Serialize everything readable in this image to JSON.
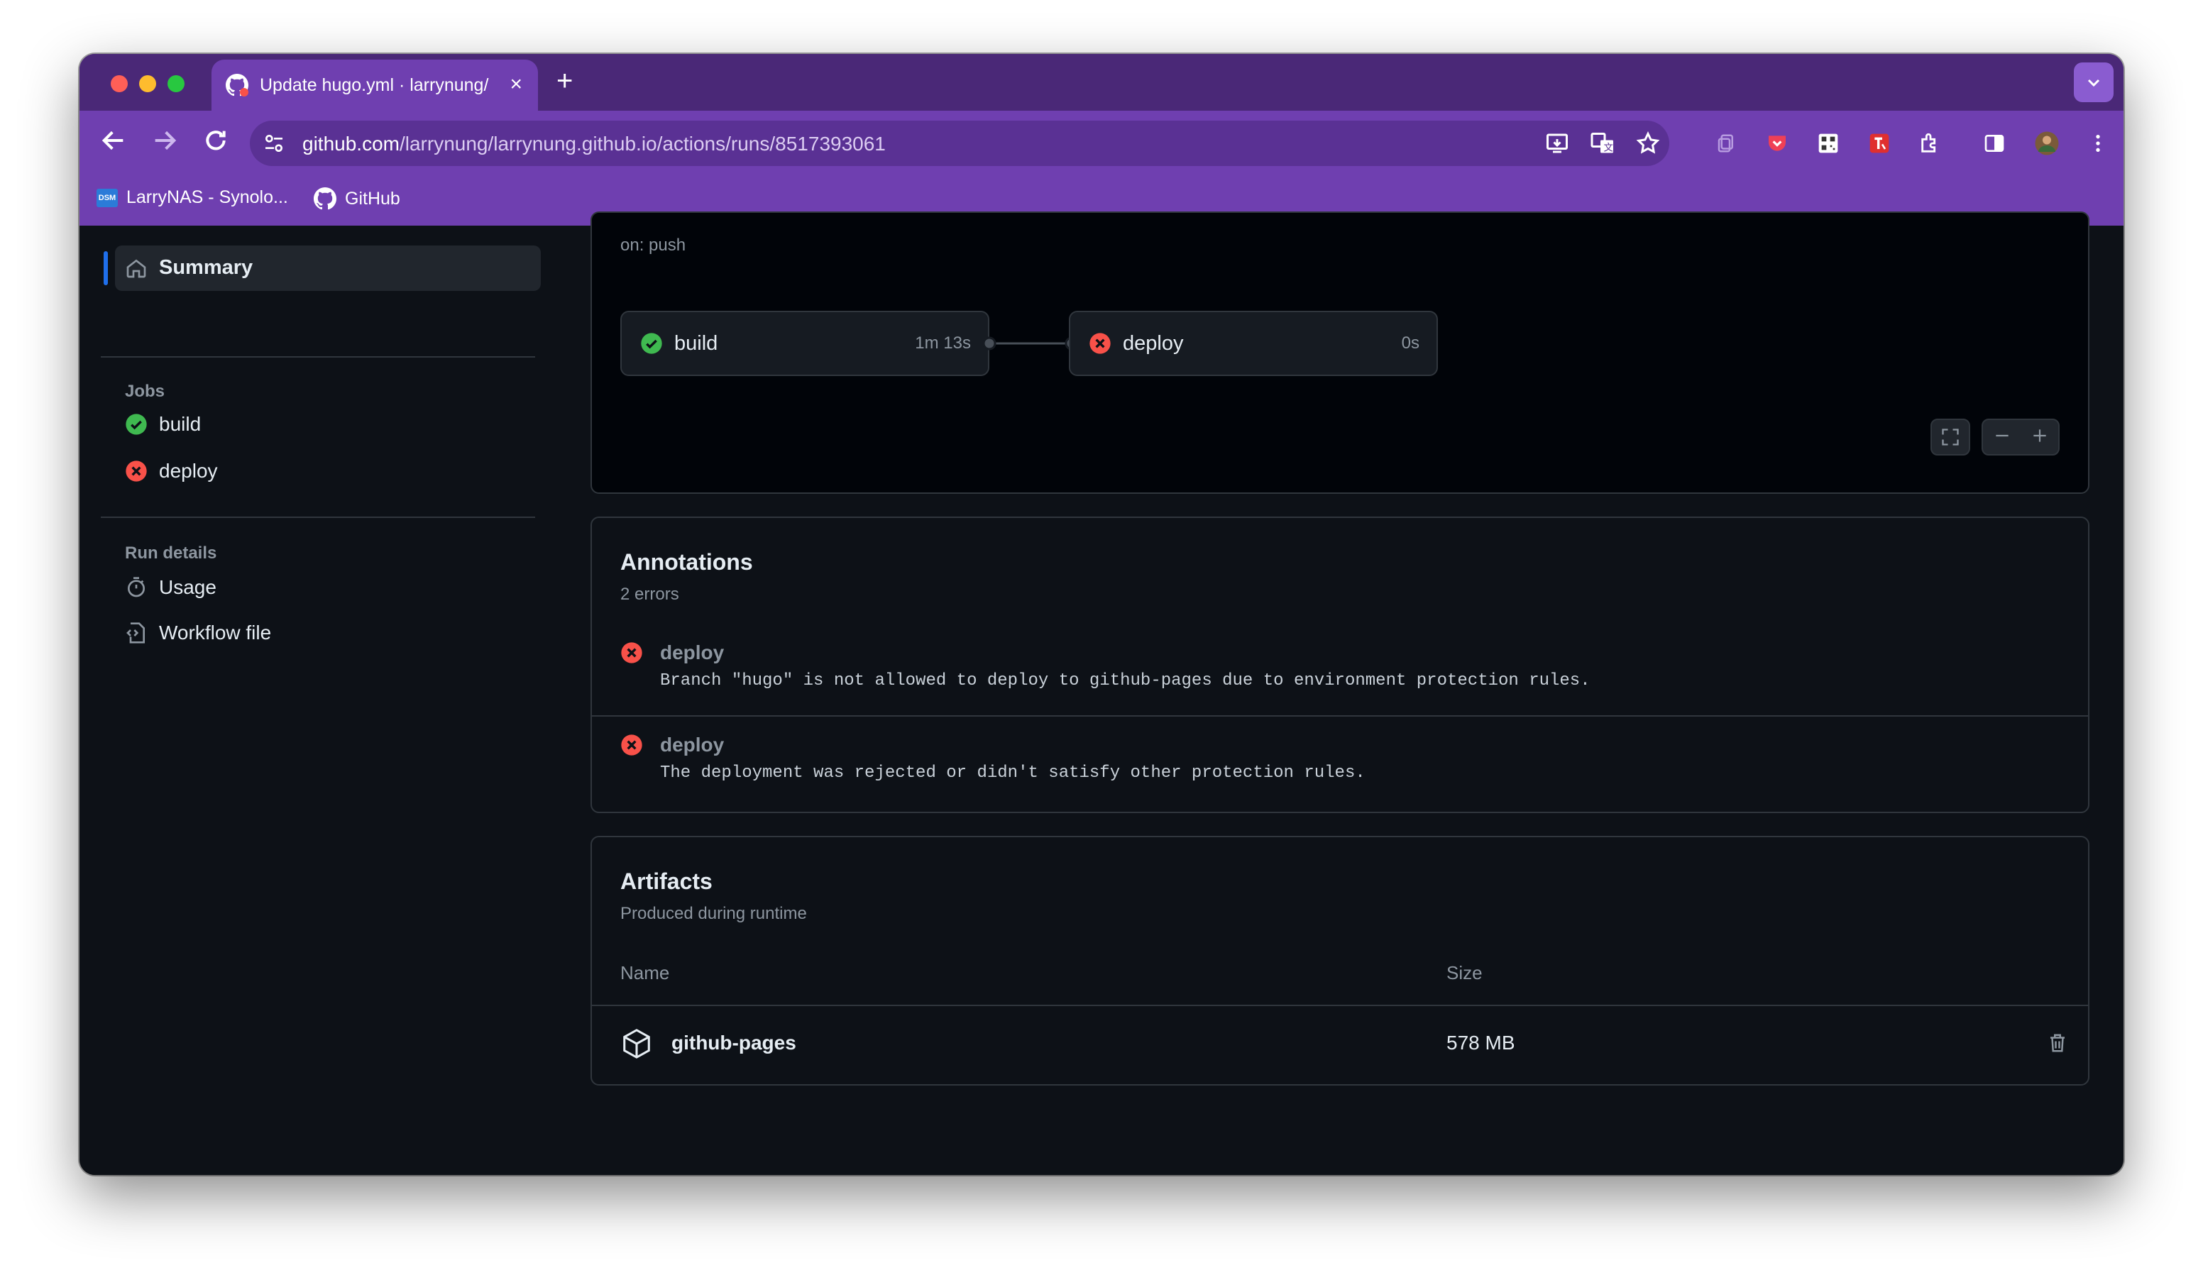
{
  "browser": {
    "tab_title": "Update hugo.yml · larrynung/",
    "url_domain": "github.com",
    "url_path": "/larrynung/larrynung.github.io/actions/runs/8517393061",
    "bookmarks": [
      "LarryNAS - Synolo...",
      "GitHub"
    ],
    "bookmark_badge": "DSM",
    "accent": "#6f3fb0"
  },
  "sidebar": {
    "summary": "Summary",
    "jobs_heading": "Jobs",
    "jobs": [
      {
        "label": "build",
        "status": "success"
      },
      {
        "label": "deploy",
        "status": "failure"
      }
    ],
    "run_details_heading": "Run details",
    "details": [
      {
        "label": "Usage",
        "icon": "stopwatch-icon"
      },
      {
        "label": "Workflow file",
        "icon": "file-code-icon"
      }
    ]
  },
  "workflow": {
    "trigger": "on: push",
    "jobs": [
      {
        "name": "build",
        "duration": "1m 13s",
        "status": "success"
      },
      {
        "name": "deploy",
        "duration": "0s",
        "status": "failure"
      }
    ]
  },
  "annotations": {
    "title": "Annotations",
    "count": "2 errors",
    "items": [
      {
        "job": "deploy",
        "message": "Branch \"hugo\" is not allowed to deploy to github-pages due to environment protection rules."
      },
      {
        "job": "deploy",
        "message": "The deployment was rejected or didn't satisfy other protection rules."
      }
    ]
  },
  "artifacts": {
    "title": "Artifacts",
    "subtitle": "Produced during runtime",
    "columns": [
      "Name",
      "Size"
    ],
    "rows": [
      {
        "name": "github-pages",
        "size": "578 MB"
      }
    ]
  },
  "colors": {
    "success": "#3fb950",
    "failure": "#f85149",
    "background": "#0d1117",
    "border": "#30363d"
  }
}
